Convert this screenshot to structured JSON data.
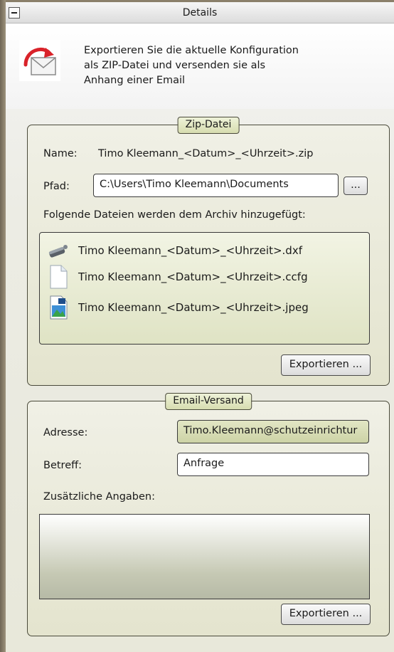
{
  "header": {
    "title": "Details"
  },
  "intro": {
    "lines": [
      "Exportieren Sie die aktuelle Konfiguration",
      "als ZIP-Datei und versenden sie als",
      "Anhang einer Email"
    ]
  },
  "zip": {
    "group_title": "Zip-Datei",
    "name_label": "Name:",
    "name_value": "Timo Kleemann_<Datum>_<Uhrzeit>.zip",
    "path_label": "Pfad:",
    "path_value": "C:\\Users\\Timo Kleemann\\Documents",
    "browse_label": "...",
    "files_caption": "Folgende Dateien werden dem Archiv hinzugefügt:",
    "files": [
      {
        "name": "Timo Kleemann_<Datum>_<Uhrzeit>.dxf",
        "icon": "dxf-file-icon"
      },
      {
        "name": "Timo Kleemann_<Datum>_<Uhrzeit>.ccfg",
        "icon": "document-file-icon"
      },
      {
        "name": "Timo Kleemann_<Datum>_<Uhrzeit>.jpeg",
        "icon": "image-file-icon"
      }
    ],
    "export_label": "Exportieren ..."
  },
  "email": {
    "group_title": "Email-Versand",
    "address_label": "Adresse:",
    "address_value": "Timo.Kleemann@schutzeinrichtur",
    "subject_label": "Betreff:",
    "subject_value": "Anfrage",
    "extra_label": "Zusätzliche Angaben:",
    "extra_value": "",
    "export_label": "Exportieren ..."
  }
}
